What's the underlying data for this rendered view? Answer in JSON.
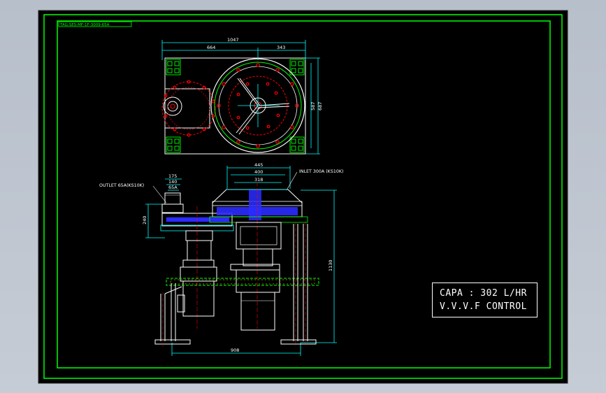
{
  "drawing": {
    "title_tag": "TAG:SES-MF-1F-3009-65A",
    "top_view": {
      "dim_overall_width": "1047",
      "dim_left": "664",
      "dim_right": "343",
      "dim_height_inner": "587",
      "dim_height_outer": "687"
    },
    "front_view": {
      "dim_top_445": "445",
      "dim_400": "400",
      "dim_318": "318",
      "dim_175": "175",
      "dim_140": "140",
      "dim_65a": "65A",
      "dim_240": "240",
      "dim_1130": "1130",
      "dim_908": "908",
      "outlet_label": "OUTLET 65A(KS10K)",
      "inlet_label": "INLET 300A (KS10K)"
    },
    "notes": {
      "line1": "CAPA : 302 L/HR",
      "line2": "V.V.V.F CONTROL"
    }
  },
  "colors": {
    "background_ui": "#b9c1cc",
    "sheet": "#000000",
    "frame": "#00ff00",
    "dim": "#00ffff",
    "outline": "#ffffff",
    "red": "#ff0000",
    "blue": "#2b2bff",
    "yellow": "#ffff00"
  }
}
